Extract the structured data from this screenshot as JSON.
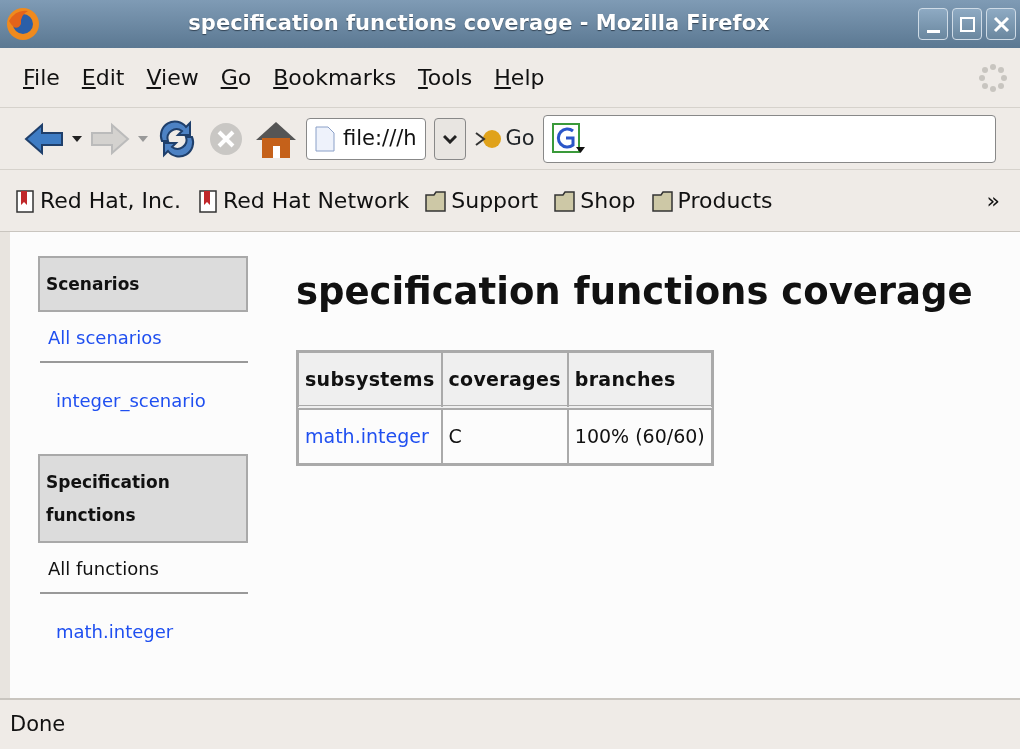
{
  "window": {
    "title": "specification functions coverage - Mozilla Firefox"
  },
  "menu": [
    {
      "label": "File"
    },
    {
      "label": "Edit"
    },
    {
      "label": "View"
    },
    {
      "label": "Go"
    },
    {
      "label": "Bookmarks"
    },
    {
      "label": "Tools"
    },
    {
      "label": "Help"
    }
  ],
  "toolbar": {
    "address": "file:///h",
    "go_label": "Go"
  },
  "bookmarks": [
    {
      "label": "Red Hat, Inc.",
      "kind": "bookmark"
    },
    {
      "label": "Red Hat Network",
      "kind": "bookmark"
    },
    {
      "label": "Support",
      "kind": "folder"
    },
    {
      "label": "Shop",
      "kind": "folder"
    },
    {
      "label": "Products",
      "kind": "folder"
    }
  ],
  "bookmarks_more": "»",
  "sidebar": [
    {
      "heading": "Scenarios",
      "items": [
        {
          "label": "All scenarios",
          "selected": false,
          "children": [
            {
              "label": "integer_scenario",
              "selected": false
            }
          ]
        }
      ]
    },
    {
      "heading": "Specification functions",
      "items": [
        {
          "label": "All functions",
          "selected": true,
          "children": [
            {
              "label": "math.integer",
              "selected": false
            }
          ]
        }
      ]
    }
  ],
  "page_title": "specification functions coverage",
  "table": {
    "columns": [
      "subsystems",
      "coverages",
      "branches"
    ],
    "rows": [
      [
        "math.integer",
        "C",
        "100% (60/60)"
      ]
    ]
  },
  "status_bar": "Done"
}
